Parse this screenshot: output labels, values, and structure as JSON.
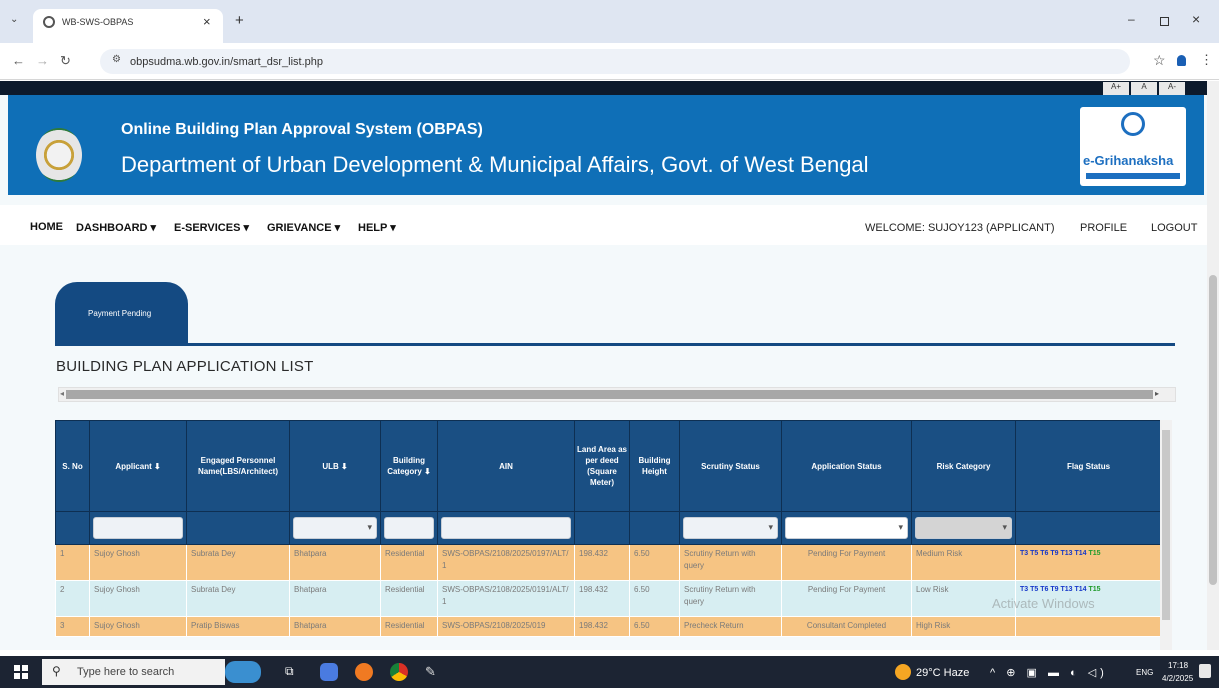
{
  "browser": {
    "tab_title": "WB-SWS-OBPAS",
    "url": "obpsudma.wb.gov.in/smart_dsr_list.php"
  },
  "header": {
    "title": "Online Building Plan Approval System (OBPAS)",
    "subtitle": "Department of Urban Development & Municipal Affairs, Govt. of West Bengal",
    "logo_text": "e-Grihanaksha",
    "font_size_controls": [
      "A+",
      "A",
      "A-"
    ]
  },
  "nav": {
    "items": [
      "HOME",
      "DASHBOARD ▾",
      "E-SERVICES ▾",
      "GRIEVANCE ▾",
      "HELP ▾"
    ],
    "welcome": "WELCOME: SUJOY123 (APPLICANT)",
    "profile": "PROFILE",
    "logout": "LOGOUT"
  },
  "tab_label": "Payment Pending",
  "list_title": "BUILDING PLAN APPLICATION LIST",
  "table": {
    "headers": [
      "S. No",
      "Applicant ⬇",
      "Engaged Personnel Name(LBS/Architect)",
      "ULB ⬇",
      "Building Category ⬇",
      "AIN",
      "Land Area as per deed (Square Meter)",
      "Building Height",
      "Scrutiny Status",
      "Application Status",
      "Risk Category",
      "Flag Status"
    ],
    "rows": [
      {
        "sno": "1",
        "applicant": "Sujoy Ghosh",
        "personnel": "Subrata Dey",
        "ulb": "Bhatpara",
        "category": "Residential",
        "ain": "SWS-OBPAS/2108/2025/0197/ALT/1",
        "land_area": "198.432",
        "height": "6.50",
        "scrutiny": "Scrutiny Return with query",
        "app_status": "Pending For Payment",
        "risk": "Medium Risk",
        "flags_blue": "T3 T5 T6 T9 T13 T14",
        "flags_green": "T15"
      },
      {
        "sno": "2",
        "applicant": "Sujoy Ghosh",
        "personnel": "Subrata Dey",
        "ulb": "Bhatpara",
        "category": "Residential",
        "ain": "SWS-OBPAS/2108/2025/0191/ALT/1",
        "land_area": "198.432",
        "height": "6.50",
        "scrutiny": "Scrutiny Return with query",
        "app_status": "Pending For Payment",
        "risk": "Low Risk",
        "flags_blue": "T3 T5 T6 T9 T13 T14",
        "flags_green": "T15"
      },
      {
        "sno": "3",
        "applicant": "Sujoy Ghosh",
        "personnel": "Pratip Biswas",
        "ulb": "Bhatpara",
        "category": "Residential",
        "ain": "SWS-OBPAS/2108/2025/019",
        "land_area": "198.432",
        "height": "6.50",
        "scrutiny": "Precheck Return",
        "app_status": "Consultant Completed",
        "risk": "High Risk",
        "flags_blue": "",
        "flags_green": ""
      }
    ]
  },
  "watermark": "Activate Windows",
  "taskbar": {
    "search_placeholder": "Type here to search",
    "weather": "29°C Haze",
    "lang": "ENG",
    "time": "17:18",
    "date": "4/2/2025"
  },
  "colors": {
    "banner": "#0f6fb7",
    "table_header": "#1a4f83",
    "row_orange": "#f6c483",
    "row_blue": "#d7eef2"
  }
}
